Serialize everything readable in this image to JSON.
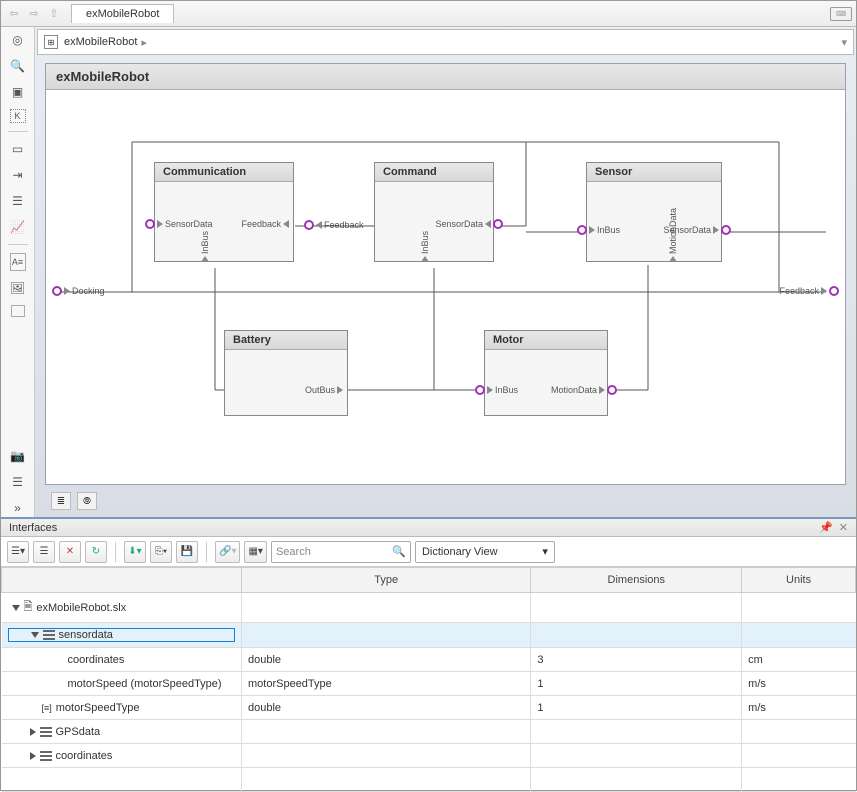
{
  "titlebar": {
    "tab": "exMobileRobot"
  },
  "breadcrumb": {
    "model": "exMobileRobot"
  },
  "diagram": {
    "title": "exMobileRobot",
    "blocks": {
      "communication": {
        "name": "Communication",
        "in1": "SensorData",
        "in2": "Feedback",
        "outlabel": "Feedback",
        "bus": "InBus"
      },
      "command": {
        "name": "Command",
        "out": "SensorData",
        "bus": "InBus"
      },
      "sensor": {
        "name": "Sensor",
        "in": "InBus",
        "out": "SensorData",
        "bus": "MotionData"
      },
      "battery": {
        "name": "Battery",
        "out": "OutBus"
      },
      "motor": {
        "name": "Motor",
        "in": "InBus",
        "out": "MotionData"
      }
    },
    "ports": {
      "left": "Docking",
      "right": "Feedback"
    }
  },
  "panel": {
    "title": "Interfaces"
  },
  "toolbar": {
    "search_placeholder": "Search",
    "view": "Dictionary View"
  },
  "table": {
    "headers": {
      "type": "Type",
      "dims": "Dimensions",
      "units": "Units"
    },
    "rows": [
      {
        "name": "exMobileRobot.slx",
        "type": "",
        "dims": "",
        "units": "",
        "level": 0,
        "expand": "d",
        "icon": "file"
      },
      {
        "name": "sensordata",
        "type": "",
        "dims": "",
        "units": "",
        "level": 1,
        "expand": "d",
        "icon": "bus",
        "selected": true
      },
      {
        "name": "coordinates",
        "type": "double",
        "dims": "3",
        "units": "cm",
        "level": 2
      },
      {
        "name": "motorSpeed (motorSpeedType)",
        "type": "motorSpeedType",
        "dims": "1",
        "units": "m/s",
        "level": 2
      },
      {
        "name": "motorSpeedType",
        "type": "double",
        "dims": "1",
        "units": "m/s",
        "level": 1,
        "icon": "elem"
      },
      {
        "name": "GPSdata",
        "type": "",
        "dims": "",
        "units": "",
        "level": 1,
        "expand": "r",
        "icon": "bus"
      },
      {
        "name": "coordinates",
        "type": "",
        "dims": "",
        "units": "",
        "level": 1,
        "expand": "r",
        "icon": "bus"
      }
    ]
  }
}
